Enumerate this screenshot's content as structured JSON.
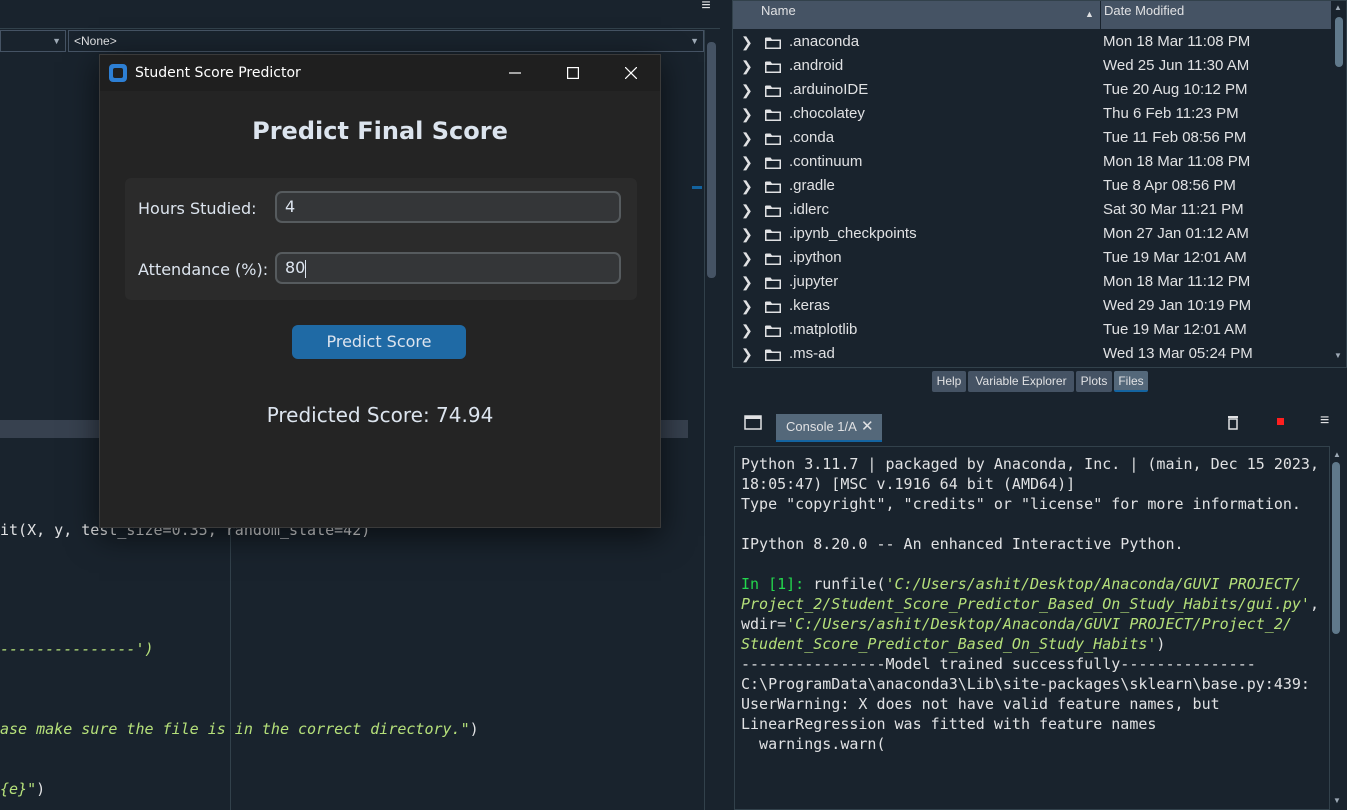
{
  "editor": {
    "combo_left": "",
    "combo_right": "<None>",
    "lines": [
      {
        "pre": "it(X, y, test_size=0.35, random_state=42)",
        "str": "",
        "post": ""
      },
      {
        "pre": "",
        "str": "---------------')",
        "post": ""
      },
      {
        "pre": "",
        "str": "ase make sure the file is in the correct directory.\"",
        "post": ")"
      },
      {
        "pre": "",
        "str": "{e}\"",
        "post": ")"
      }
    ]
  },
  "files": {
    "col_name": "Name",
    "col_date": "Date Modified",
    "rows": [
      {
        "name": ".anaconda",
        "date": "Mon 18 Mar 11:08 PM"
      },
      {
        "name": ".android",
        "date": "Wed 25 Jun 11:30 AM"
      },
      {
        "name": ".arduinoIDE",
        "date": "Tue 20 Aug 10:12 PM"
      },
      {
        "name": ".chocolatey",
        "date": "Thu 6 Feb 11:23 PM"
      },
      {
        "name": ".conda",
        "date": "Tue 11 Feb 08:56 PM"
      },
      {
        "name": ".continuum",
        "date": "Mon 18 Mar 11:08 PM"
      },
      {
        "name": ".gradle",
        "date": "Tue 8 Apr 08:56 PM"
      },
      {
        "name": ".idlerc",
        "date": "Sat 30 Mar 11:21 PM"
      },
      {
        "name": ".ipynb_checkpoints",
        "date": "Mon 27 Jan 01:12 AM"
      },
      {
        "name": ".ipython",
        "date": "Tue 19 Mar 12:01 AM"
      },
      {
        "name": ".jupyter",
        "date": "Mon 18 Mar 11:12 PM"
      },
      {
        "name": ".keras",
        "date": "Wed 29 Jan 10:19 PM"
      },
      {
        "name": ".matplotlib",
        "date": "Tue 19 Mar 12:01 AM"
      },
      {
        "name": ".ms-ad",
        "date": "Wed 13 Mar 05:24 PM"
      }
    ]
  },
  "dock_tabs": [
    "Help",
    "Variable Explorer",
    "Plots",
    "Files"
  ],
  "console": {
    "tab_label": "Console 1/A",
    "banner": [
      "Python 3.11.7 | packaged by Anaconda, Inc. | (main, Dec 15 2023,",
      "18:05:47) [MSC v.1916 64 bit (AMD64)]",
      "Type \"copyright\", \"credits\" or \"license\" for more information.",
      "",
      "IPython 8.20.0 -- An enhanced Interactive Python."
    ],
    "prompt": "In [1]: ",
    "cmd_1": "runfile(",
    "cmd_1_str": "'C:/Users/ashit/Desktop/Anaconda/GUVI PROJECT/",
    "cmd_2_str": "Project_2/Student_Score_Predictor_Based_On_Study_Habits/gui.py'",
    "cmd_2_end": ",",
    "cmd_3": "wdir=",
    "cmd_3_str": "'C:/Users/ashit/Desktop/Anaconda/GUVI PROJECT/Project_2/",
    "cmd_4_str": "Student_Score_Predictor_Based_On_Study_Habits'",
    "cmd_4_end": ")",
    "output": [
      "----------------Model trained successfully---------------",
      "C:\\ProgramData\\anaconda3\\Lib\\site-packages\\sklearn\\base.py:439:",
      "UserWarning: X does not have valid feature names, but",
      "LinearRegression was fitted with feature names",
      "  warnings.warn("
    ]
  },
  "dialog": {
    "title": "Student Score Predictor",
    "heading": "Predict Final Score",
    "hours_label": "Hours Studied:",
    "hours_value": "4",
    "attendance_label": "Attendance (%):",
    "attendance_value": "80",
    "button": "Predict Score",
    "result": "Predicted Score: 74.94"
  },
  "colors": {
    "accent": "#1f6aa5",
    "console_prompt": "#23d64d",
    "string": "#b5e07a"
  }
}
